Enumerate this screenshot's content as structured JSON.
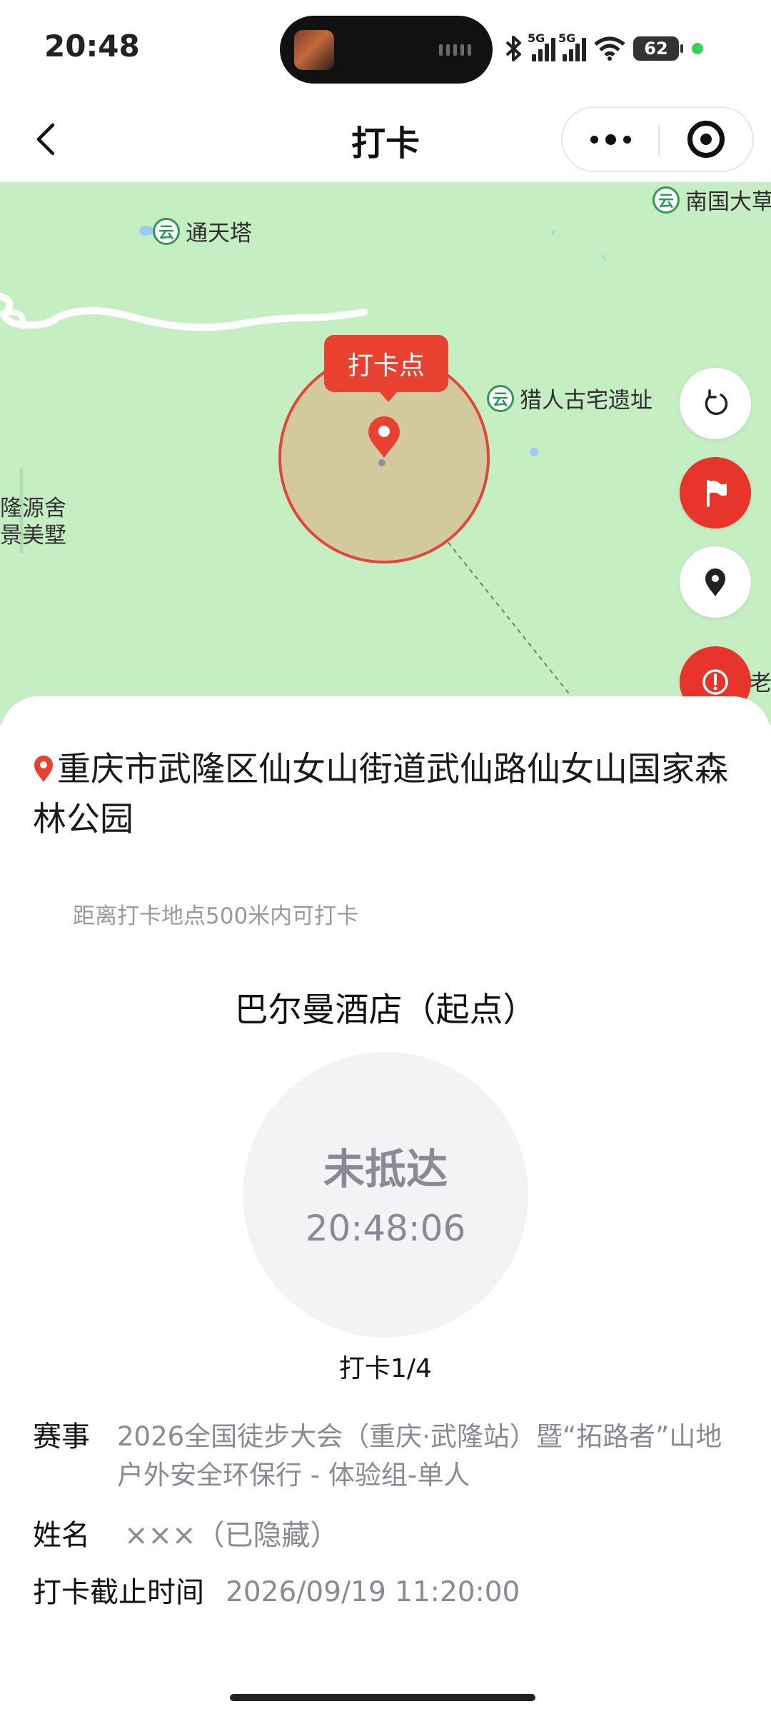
{
  "status_bar": {
    "time": "20:48",
    "battery": "62",
    "network_left": "5G",
    "network_right": "5G"
  },
  "nav": {
    "title": "打卡"
  },
  "map": {
    "pois": [
      {
        "name": "通天塔",
        "icon": "scenic-spot-icon"
      },
      {
        "name": "猎人古宅遗址",
        "icon": "scenic-spot-icon"
      },
      {
        "name": "南国大草",
        "icon": "scenic-spot-icon"
      },
      {
        "name": "老",
        "icon": "scenic-spot-icon"
      }
    ],
    "side_label_line1": "隆源舍",
    "side_label_line2": "景美墅",
    "checkin_label": "打卡点",
    "accent_color": "#e8412f",
    "buttons": [
      {
        "name": "refresh",
        "icon": "refresh-icon"
      },
      {
        "name": "flag",
        "icon": "flag-icon"
      },
      {
        "name": "locate",
        "icon": "location-pin-icon"
      },
      {
        "name": "alert",
        "icon": "alert-icon"
      }
    ]
  },
  "sheet": {
    "address": "重庆市武隆区仙女山街道武仙路仙女山国家森林公园",
    "hint": "距离打卡地点500米内可打卡",
    "point_name": "巴尔曼酒店（起点）",
    "status_text": "未抵达",
    "status_time": "20:48:06",
    "progress": "打卡1/4",
    "event_label": "赛事",
    "event_value": "2026全国徒步大会（重庆·武隆站）暨“拓路者”山地户外安全环保行 - 体验组-单人",
    "name_label": "姓名",
    "name_value": "×××（已隐藏）",
    "deadline_label": "打卡截止时间",
    "deadline_value": "2026/09/19 11:20:00"
  }
}
